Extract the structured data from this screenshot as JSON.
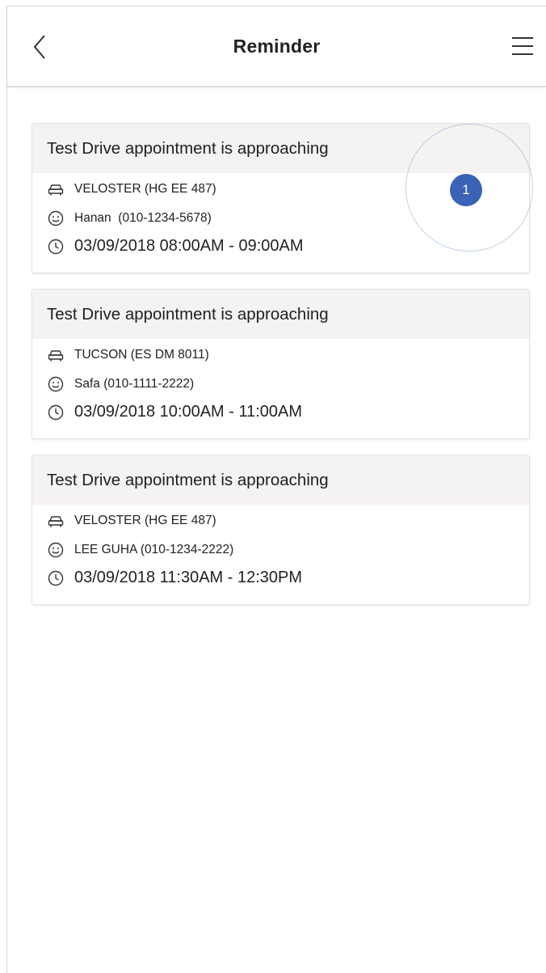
{
  "header": {
    "title": "Reminder",
    "back_icon": "chevron-left-icon",
    "menu_icon": "hamburger-menu-icon"
  },
  "badge": {
    "label": "1",
    "color": "#3a62b6"
  },
  "reminders": [
    {
      "title": "Test Drive appointment is approaching",
      "vehicle": "VELOSTER (HG EE 487)",
      "customer": "Hanan  (010-1234-5678)",
      "time": "03/09/2018 08:00AM - 09:00AM"
    },
    {
      "title": "Test Drive appointment is approaching",
      "vehicle": "TUCSON (ES DM 8011)",
      "customer": "Safa (010-1111-2222)",
      "time": "03/09/2018 10:00AM - 11:00AM"
    },
    {
      "title": "Test Drive appointment is approaching",
      "vehicle": "VELOSTER (HG EE 487)",
      "customer": "LEE GUHA (010-1234-2222)",
      "time": "03/09/2018 11:30AM - 12:30PM"
    }
  ],
  "icons": {
    "vehicle": "car-icon",
    "customer": "smiley-face-icon",
    "time": "clock-icon"
  }
}
